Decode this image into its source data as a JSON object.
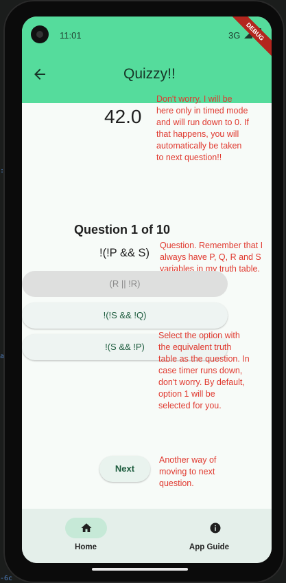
{
  "status_bar": {
    "time": "11:01",
    "network": "3G",
    "debug_banner": "DEBUG"
  },
  "app_bar": {
    "title": "Quizzy!!",
    "back_icon": "arrow-left-icon"
  },
  "timer": {
    "value": "42.0"
  },
  "notes": {
    "timer_note": [
      "Don't worry, I will be",
      "here only in timed mode",
      "and will run down to 0. If",
      "that happens, you will",
      "automatically be taken",
      "to next question!!"
    ],
    "question_note": [
      "Question. Remember that I",
      "always have P, Q, R and S",
      "variables in my truth table."
    ],
    "options_note": [
      "Select the option with",
      "the equivalent truth",
      "table as the question. In",
      "case timer runs down,",
      "don't worry. By default,",
      "option 1 will be",
      "selected for you."
    ],
    "next_note": [
      "Another way of",
      "moving to next",
      "question."
    ]
  },
  "question": {
    "heading": "Question 1 of 10",
    "expression": "!(!P && S)"
  },
  "options": [
    {
      "label": "(R || !R)",
      "selected": true
    },
    {
      "label": "!(!S && !Q)",
      "selected": false
    },
    {
      "label": "!(S && !P)",
      "selected": false
    }
  ],
  "next_button": {
    "label": "Next"
  },
  "bottom_nav": [
    {
      "label": "Home",
      "icon": "home-icon",
      "active": true
    },
    {
      "label": "App Guide",
      "icon": "info-icon",
      "active": false
    }
  ],
  "colors": {
    "app_bar": "#55dc9c",
    "note_text": "#e0392f",
    "accent_text": "#1c5b3d",
    "nav_bg": "#e4efea"
  }
}
